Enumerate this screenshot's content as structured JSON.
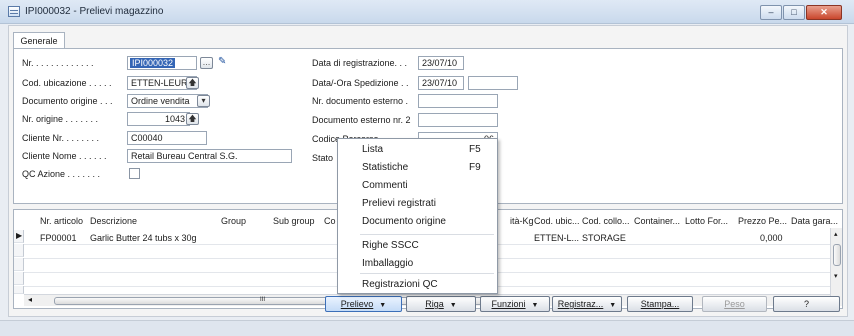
{
  "window": {
    "title": "IPI000032 - Prelievi magazzino",
    "min": "–",
    "max": "□",
    "close": "✕"
  },
  "tabs": [
    {
      "label": "Generale"
    }
  ],
  "left_fields": [
    {
      "label": "Nr. . . . . . . . . . . . .",
      "value": "IPI000032"
    },
    {
      "label": "Cod. ubicazione . . . . .",
      "value": "ETTEN-LEUR"
    },
    {
      "label": "Documento origine . . .",
      "value": "Ordine vendita"
    },
    {
      "label": "Nr. origine . . . . . . .",
      "value": "1043"
    },
    {
      "label": "Cliente Nr. . . . . . . .",
      "value": "C00040"
    },
    {
      "label": "Cliente Nome . . . . . .",
      "value": "Retail Bureau Central S.G."
    },
    {
      "label": "QC Azione . . . . . . .",
      "value": ""
    }
  ],
  "right_fields": [
    {
      "label": "Data di registrazione. . .",
      "value": "23/07/10"
    },
    {
      "label": "Data/-Ora Spedizione . .",
      "value": "23/07/10"
    },
    {
      "label": "Nr. documento esterno .",
      "value": ""
    },
    {
      "label": "Documento esterno nr. 2",
      "value": ""
    },
    {
      "label": "Codice Percorso . . . . .",
      "value": "06"
    },
    {
      "label": "Stato",
      "value": ""
    }
  ],
  "grid": {
    "headers": [
      "Nr. articolo",
      "Descrizione",
      "Group",
      "Sub group",
      "Co",
      "ità-Kg",
      "Cod. ubic...",
      "Cod. collo...",
      "Container...",
      "Lotto For...",
      "Prezzo Pe...",
      "Data gara..."
    ],
    "row": {
      "item": "FP00001",
      "desc": "Garlic Butter 24 tubs x 30g",
      "ubic": "ETTEN-L...",
      "collo": "STORAGE",
      "prezzo": "0,000"
    },
    "scroll_grip": "III"
  },
  "context_menu": [
    {
      "label": "Lista",
      "key": "F5"
    },
    {
      "label": "Statistiche",
      "key": "F9"
    },
    {
      "label": "Commenti",
      "key": ""
    },
    {
      "label": "Prelievi registrati",
      "key": ""
    },
    {
      "label": "Documento origine",
      "key": ""
    },
    {
      "label": "Righe SSCC",
      "key": ""
    },
    {
      "label": "Imballaggio",
      "key": ""
    },
    {
      "label": "Registrazioni QC",
      "key": ""
    }
  ],
  "buttons": {
    "prelievo": "Prelievo",
    "riga": "Riga",
    "funzioni": "Funzioni",
    "registraz": "Registraz...",
    "stampa": "Stampa...",
    "peso": "Peso",
    "help": "?"
  }
}
